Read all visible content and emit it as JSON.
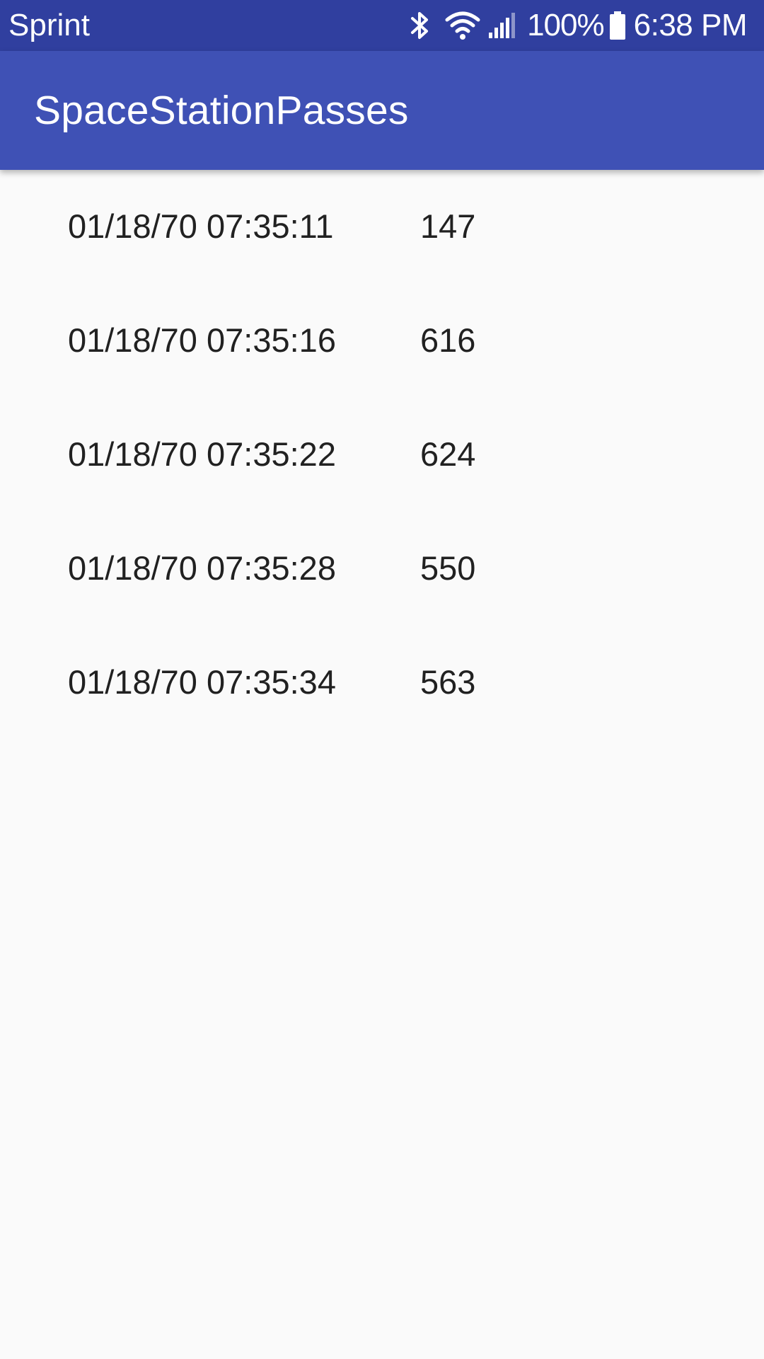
{
  "status_bar": {
    "carrier": "Sprint",
    "battery_percent": "100%",
    "time": "6:38 PM",
    "icons": [
      "bluetooth-icon",
      "wifi-icon",
      "cell-signal-icon",
      "battery-icon"
    ],
    "background_color": "#303f9f"
  },
  "app_bar": {
    "title": "SpaceStationPasses",
    "background_color": "#3f51b5"
  },
  "passes": [
    {
      "datetime": "01/18/70 07:35:11",
      "duration": "147"
    },
    {
      "datetime": "01/18/70 07:35:16",
      "duration": "616"
    },
    {
      "datetime": "01/18/70 07:35:22",
      "duration": "624"
    },
    {
      "datetime": "01/18/70 07:35:28",
      "duration": "550"
    },
    {
      "datetime": "01/18/70 07:35:34",
      "duration": "563"
    }
  ]
}
